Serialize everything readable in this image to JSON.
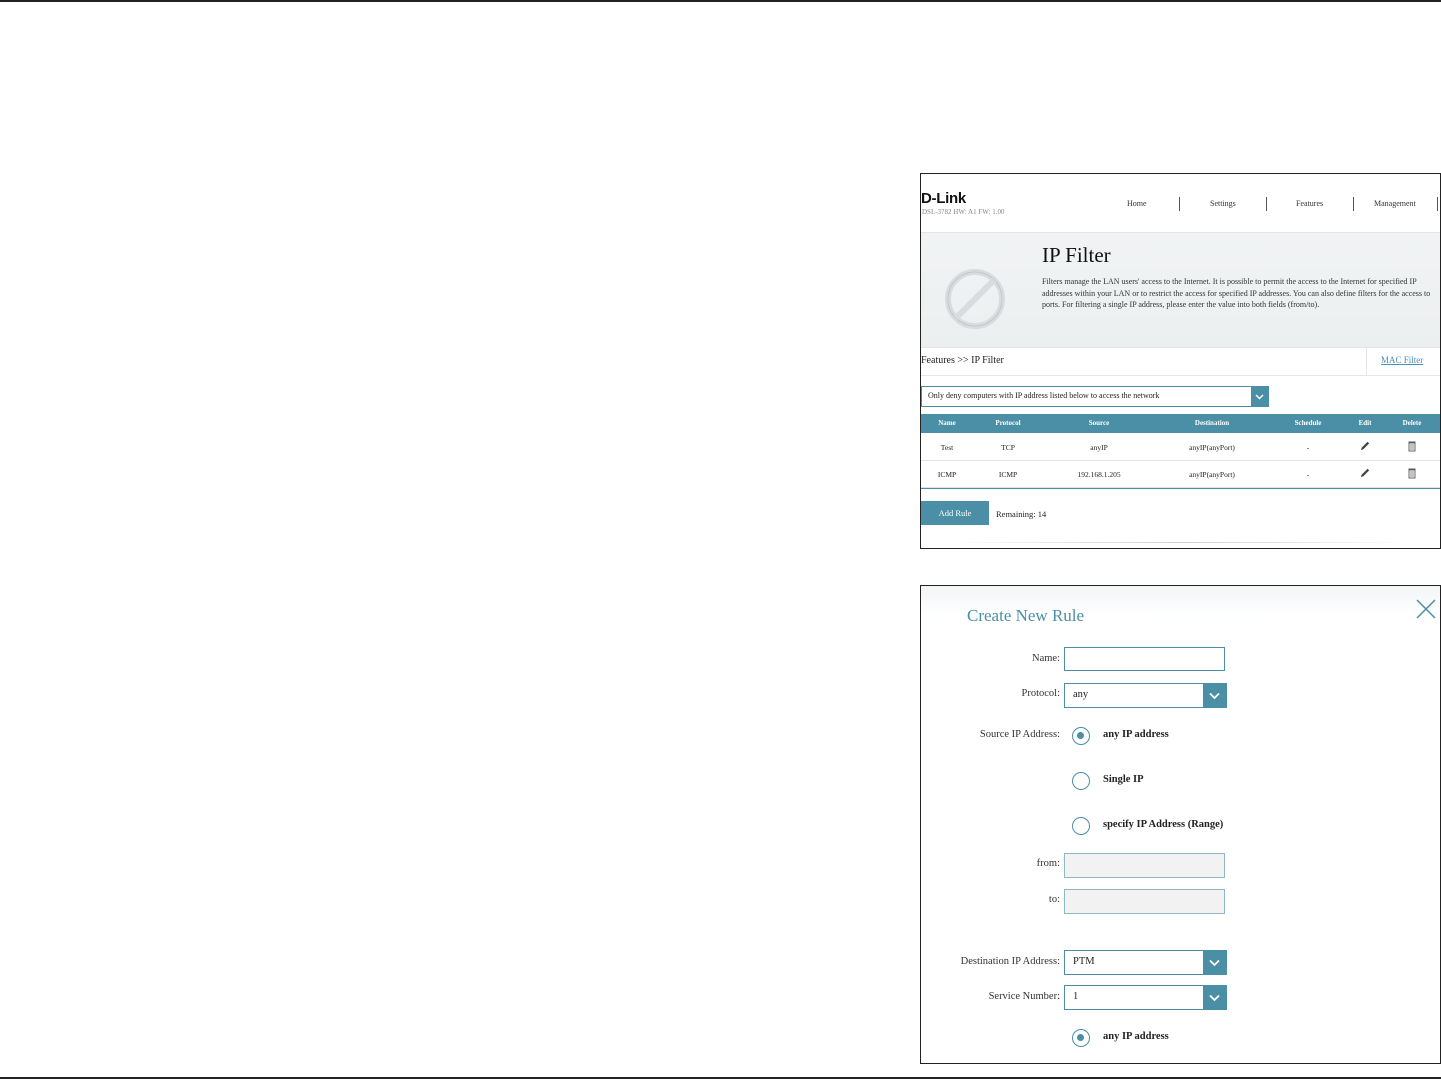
{
  "router_page": {
    "brand": "D-Link",
    "model_info": "DSL-3782  HW: A1  FW: 1.00",
    "nav": [
      "Home",
      "Settings",
      "Features",
      "Management"
    ],
    "title": "IP Filter",
    "description": "Filters manage the LAN users' access to the Internet. It is possible to permit the access to the Internet for specified IP addresses within your LAN or to restrict the access for specified IP addresses. You can also define filters for the access to ports. For filtering a single IP address, please enter the value into both fields (from/to).",
    "breadcrumb": "Features >> IP Filter",
    "mac_filter_link": "MAC Filter",
    "filter_mode": "Only deny computers with IP address listed below to access the network",
    "table": {
      "headers": [
        "Name",
        "Protocol",
        "Source",
        "Destination",
        "Schedule",
        "Edit",
        "Delete"
      ],
      "rows": [
        [
          "Test",
          "TCP",
          "anyIP",
          "anyIP(anyPort)",
          "-"
        ],
        [
          "ICMP",
          "ICMP",
          "192.168.1.205",
          "anyIP(anyPort)",
          "-"
        ]
      ]
    },
    "add_rule_label": "Add Rule",
    "remaining": "Remaining: 14"
  },
  "create_rule": {
    "title": "Create New Rule",
    "name_label": "Name:",
    "name_value": "",
    "protocol_label": "Protocol:",
    "protocol_value": "any",
    "source_label": "Source IP Address:",
    "source_options": [
      "any IP address",
      "Single IP",
      "specify IP Address (Range)"
    ],
    "source_selected": 0,
    "from_label": "from:",
    "to_label": "to:",
    "destination_label": "Destination IP Address:",
    "destination_value": "PTM",
    "service_label": "Service Number:",
    "service_value": "1",
    "destination_option": "any IP address"
  },
  "colors": {
    "accent": "#4a8fa6",
    "link": "#4a90b8"
  },
  "icons": [
    "ip-filter-prohibit-icon",
    "chevron-down-icon",
    "pencil-icon",
    "trash-icon",
    "close-icon"
  ]
}
